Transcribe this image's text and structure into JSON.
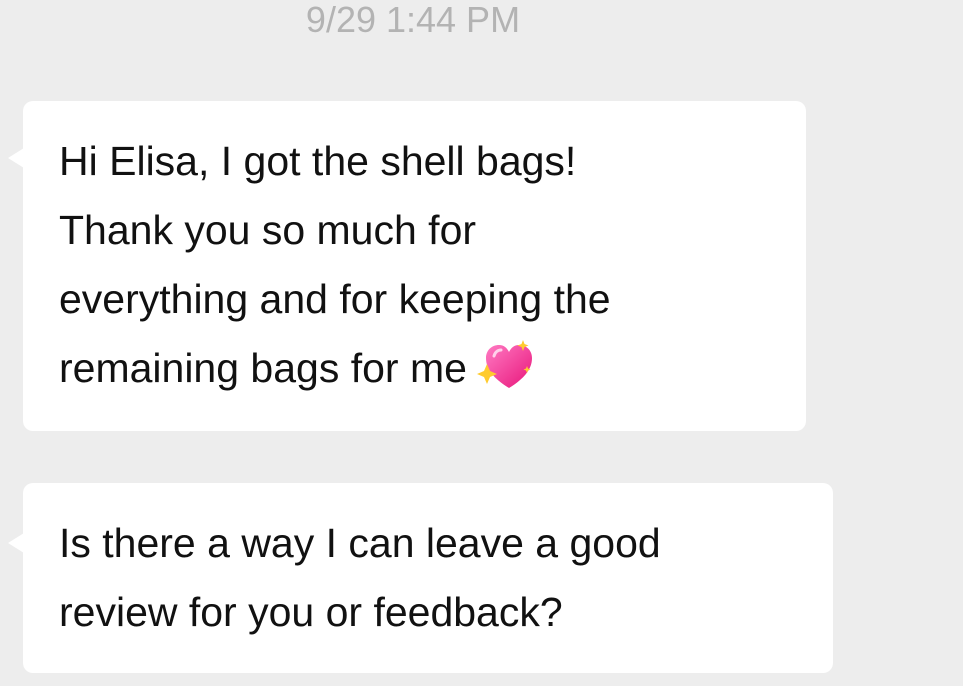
{
  "conversation": {
    "timestamp": "9/29 1:44 PM",
    "messages": [
      {
        "lines": [
          "Hi Elisa, I got the shell bags!",
          "Thank you so much for",
          "everything and for keeping the",
          "remaining bags for me"
        ],
        "emoji": "sparkling-heart-icon",
        "emoji_color": "#ff3f9f"
      },
      {
        "lines": [
          "Is there a way I can leave a good",
          "review for you or feedback?"
        ]
      }
    ]
  },
  "colors": {
    "background": "#ededed",
    "bubble": "#ffffff",
    "text": "#111111",
    "timestamp": "#b3b3b3"
  }
}
